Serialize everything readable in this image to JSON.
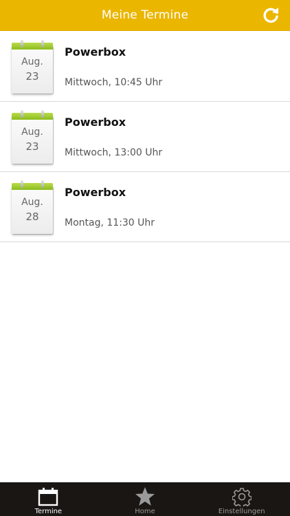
{
  "header": {
    "title": "Meine Termine",
    "refresh_icon": "refresh-icon",
    "background_color": "#ebb600"
  },
  "appointments": [
    {
      "month": "Aug.",
      "day": "23",
      "title": "Powerbox",
      "time": "Mittwoch, 10:45 Uhr"
    },
    {
      "month": "Aug.",
      "day": "23",
      "title": "Powerbox",
      "time": "Mittwoch, 13:00 Uhr"
    },
    {
      "month": "Aug.",
      "day": "28",
      "title": "Powerbox",
      "time": "Montag, 11:30 Uhr"
    }
  ],
  "tabbar": {
    "tabs": [
      {
        "label": "Termine",
        "icon": "calendar-icon",
        "active": true
      },
      {
        "label": "Home",
        "icon": "star-icon",
        "active": false
      },
      {
        "label": "Einstellungen",
        "icon": "gear-icon",
        "active": false
      }
    ],
    "background_color": "#1a1614"
  }
}
